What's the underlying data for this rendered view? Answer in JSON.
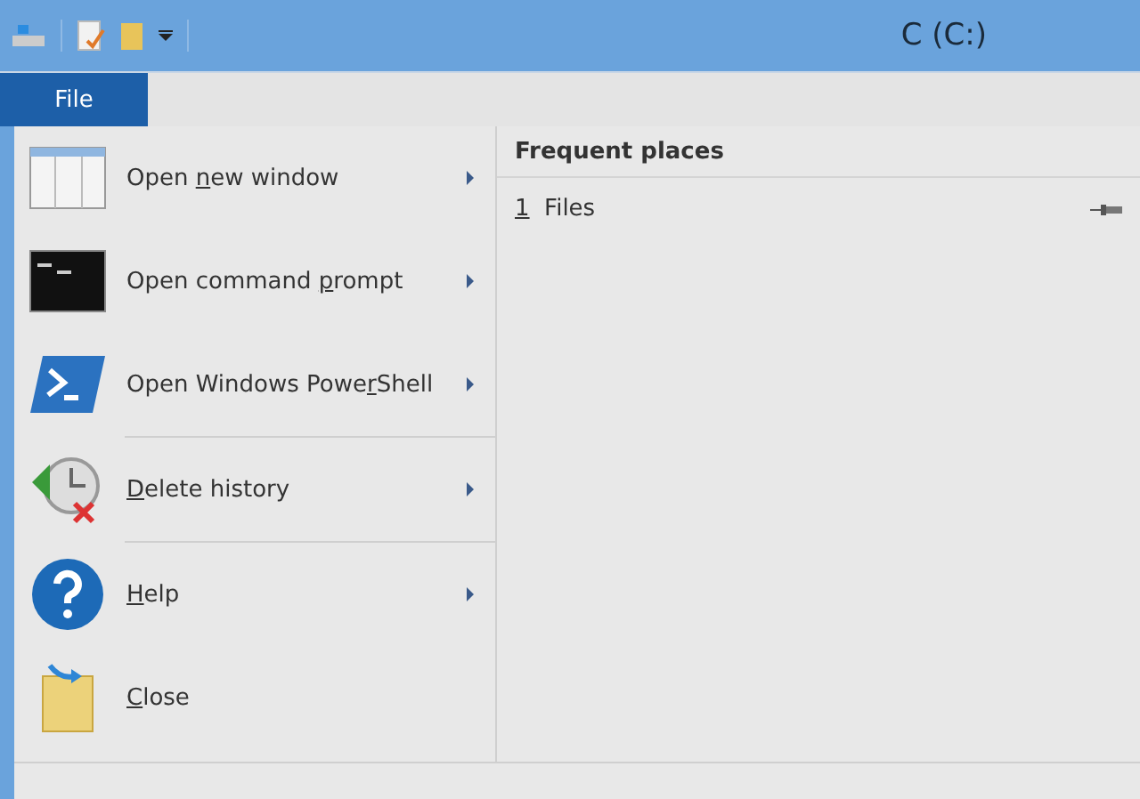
{
  "window": {
    "title": "C (C:)"
  },
  "ribbon": {
    "file_tab": {
      "label": "File",
      "selected": true
    }
  },
  "menu": {
    "items": [
      {
        "kind": "newwindow",
        "pre": "Open ",
        "key": "n",
        "post": "ew window",
        "submenu": true,
        "separator_after": false
      },
      {
        "kind": "cmd",
        "pre": "Open command ",
        "key": "p",
        "post": "rompt",
        "submenu": true,
        "separator_after": false
      },
      {
        "kind": "powershell",
        "pre": "Open Windows Powe",
        "key": "r",
        "post": "Shell",
        "submenu": true,
        "separator_after": true
      },
      {
        "kind": "history",
        "key": "D",
        "post": "elete history",
        "submenu": true,
        "separator_after": true
      },
      {
        "kind": "help",
        "key": "H",
        "post": "elp",
        "submenu": true,
        "separator_after": false
      },
      {
        "kind": "close",
        "key": "C",
        "post": "lose",
        "submenu": false,
        "separator_after": false
      }
    ]
  },
  "frequent_places": {
    "title": "Frequent places",
    "items": [
      {
        "number": "1",
        "name": "Files",
        "pinned": true
      }
    ]
  }
}
